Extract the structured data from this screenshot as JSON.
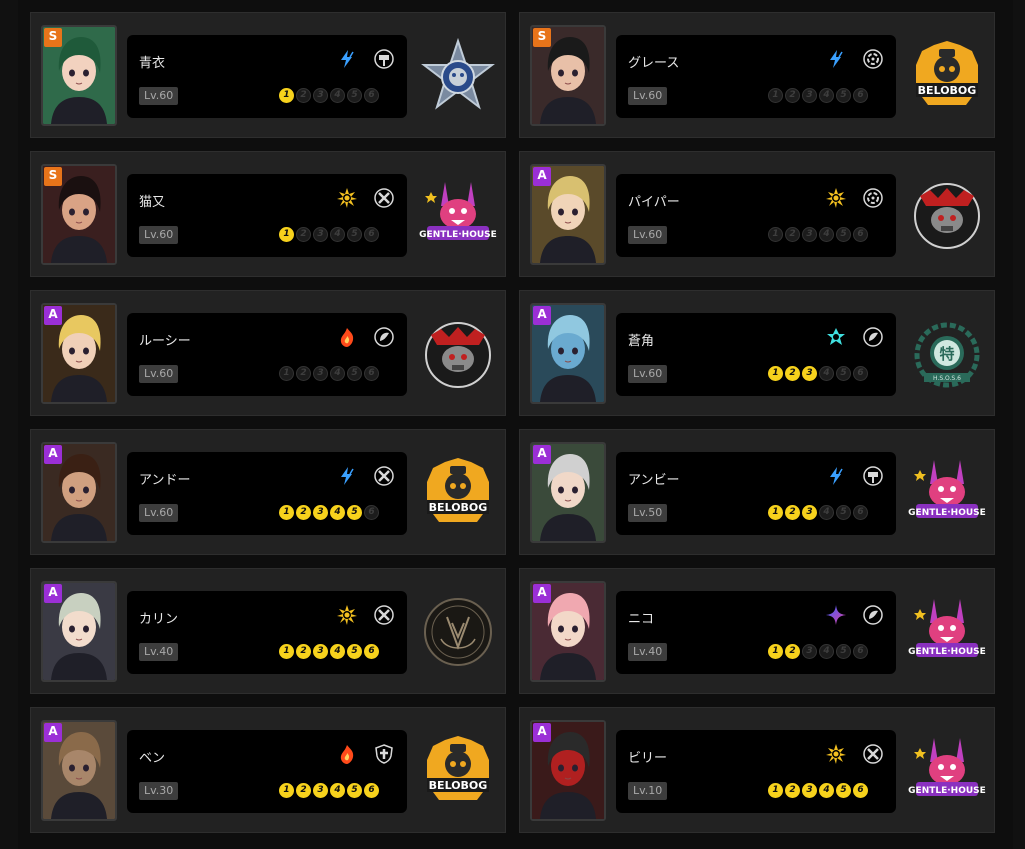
{
  "agents": [
    {
      "name": "青衣",
      "rank": "S",
      "level": "Lv.60",
      "attribute": "electric-icon",
      "specialty": "stun-icon",
      "cinema": 1,
      "faction": "police-badge-faction",
      "portrait_color": "#2f6a4a",
      "hair": "#1f5a3a",
      "skin": "#f2d2bf"
    },
    {
      "name": "グレース",
      "rank": "S",
      "level": "Lv.60",
      "attribute": "electric-icon",
      "specialty": "anomaly-icon",
      "cinema": 0,
      "faction": "belobog-faction",
      "portrait_color": "#3a2a2a",
      "hair": "#1a1a1a",
      "skin": "#e8c0a8"
    },
    {
      "name": "猫又",
      "rank": "S",
      "level": "Lv.60",
      "attribute": "physical-icon",
      "specialty": "attack-icon",
      "cinema": 1,
      "faction": "gentle-house-faction",
      "portrait_color": "#3a1f1f",
      "hair": "#1a1010",
      "skin": "#d9a385"
    },
    {
      "name": "パイパー",
      "rank": "A",
      "level": "Lv.60",
      "attribute": "physical-icon",
      "specialty": "anomaly-icon",
      "cinema": 0,
      "faction": "sons-of-calydon-faction",
      "portrait_color": "#5a4a2a",
      "hair": "#d8c070",
      "skin": "#f0d4b8"
    },
    {
      "name": "ルーシー",
      "rank": "A",
      "level": "Lv.60",
      "attribute": "fire-icon",
      "specialty": "support-icon",
      "cinema": 0,
      "faction": "sons-of-calydon-faction",
      "portrait_color": "#3a2a1a",
      "hair": "#e8c860",
      "skin": "#f0d0b8"
    },
    {
      "name": "蒼角",
      "rank": "A",
      "level": "Lv.60",
      "attribute": "ice-icon",
      "specialty": "support-icon",
      "cinema": 3,
      "faction": "hsos6-faction",
      "portrait_color": "#2a4a5a",
      "hair": "#90c8e0",
      "skin": "#6aaad0"
    },
    {
      "name": "アンドー",
      "rank": "A",
      "level": "Lv.60",
      "attribute": "electric-icon",
      "specialty": "attack-icon",
      "cinema": 5,
      "faction": "belobog-faction",
      "portrait_color": "#3a2a22",
      "hair": "#3a2014",
      "skin": "#d0a080"
    },
    {
      "name": "アンビー",
      "rank": "A",
      "level": "Lv.50",
      "attribute": "electric-icon",
      "specialty": "stun-icon",
      "cinema": 3,
      "faction": "gentle-house-faction",
      "portrait_color": "#3a4a3a",
      "hair": "#d0d0d0",
      "skin": "#f0d8c8"
    },
    {
      "name": "カリン",
      "rank": "A",
      "level": "Lv.40",
      "attribute": "physical-icon",
      "specialty": "attack-icon",
      "cinema": 6,
      "faction": "victoria-faction",
      "portrait_color": "#3a3a44",
      "hair": "#c8d0c0",
      "skin": "#f2dccc"
    },
    {
      "name": "ニコ",
      "rank": "A",
      "level": "Lv.40",
      "attribute": "ether-icon",
      "specialty": "support-icon",
      "cinema": 2,
      "faction": "gentle-house-faction",
      "portrait_color": "#4a2a34",
      "hair": "#f0a8b0",
      "skin": "#f2d8c8"
    },
    {
      "name": "ベン",
      "rank": "A",
      "level": "Lv.30",
      "attribute": "fire-icon",
      "specialty": "defense-icon",
      "cinema": 6,
      "faction": "belobog-faction",
      "portrait_color": "#5a4a3a",
      "hair": "#8a6a4a",
      "skin": "#a8866a"
    },
    {
      "name": "ビリー",
      "rank": "A",
      "level": "Lv.10",
      "attribute": "physical-icon",
      "specialty": "attack-icon",
      "cinema": 6,
      "faction": "gentle-house-faction",
      "portrait_color": "#3a1a1a",
      "hair": "#2a2a2a",
      "skin": "#b02020"
    }
  ],
  "cinema_labels": [
    "1",
    "2",
    "3",
    "4",
    "5",
    "6"
  ],
  "colors": {
    "electric": "#3aa0ff",
    "physical": "#f3c020",
    "fire": "#ff4a1a",
    "ice": "#40e0e0",
    "ether": "#e040a0",
    "cinema_on": "#f7d21c"
  }
}
